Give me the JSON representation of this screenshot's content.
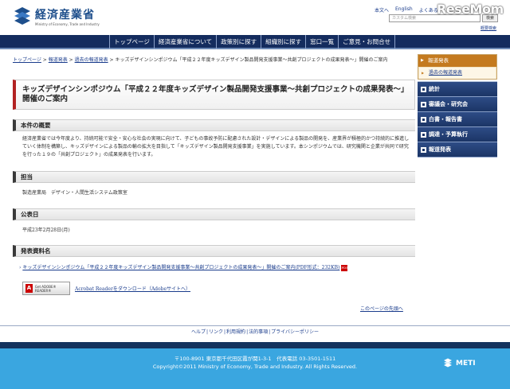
{
  "header": {
    "logo_text": "経済産業省",
    "logo_sub": "Ministry of Economy, Trade and Industry",
    "top_links": [
      "本文へ",
      "English",
      "よくある"
    ],
    "search_placeholder": "カスタム検索",
    "search_button": "検索",
    "sitemap": "概要検索",
    "watermark": "ReseMom"
  },
  "nav": {
    "items": [
      "トップページ",
      "経済産業省について",
      "政策別に探す",
      "組織別に探す",
      "窓口一覧",
      "ご意見・お問合せ"
    ]
  },
  "breadcrumb": {
    "items": [
      "トップページ",
      "報道発表",
      "過去の報道発表"
    ],
    "current": "キッズデザインシンポジウム「平成２２年度キッズデザイン製品開発支援事業〜共創プロジェクトの成果発表〜」開催のご案内"
  },
  "page_title": "キッズデザインシンポジウム「平成２２年度キッズデザイン製品開発支援事業〜共創プロジェクトの成果発表〜」開催のご案内",
  "sections": {
    "summary": {
      "heading": "本件の概要",
      "text": "経済産業省では今年度より、持続可能で安全・安心な社会の実現に向けて、子どもの事故予防に配慮された設計・デザインによる製品の開発を、産業界が積極的かつ持続的に推進していく体制を構築し、キッズデザインによる製品の輸の拡大を目指して「キッズデザイン製品開発支援事業」を実施しています。本シンポジウムでは、研究機関と企業が共同で研究を行った１９の「共創プロジェクト」の成果発表を行います。"
    },
    "contact": {
      "heading": "担当",
      "text": "製造産業局　デザイン・人間生活システム政策室"
    },
    "date": {
      "heading": "公表日",
      "text": "平成23年2月28日(月)"
    },
    "materials": {
      "heading": "発表資料名",
      "pdf_link": "キッズデザインシンポジウム「平成２２年度キッズデザイン製品開発支援事業〜共創プロジェクトの成果発表〜」開催のご案内(PDF形式：232KB)",
      "pdf_icon": "PDF",
      "adobe_badge": "Get ADOBE® READER®",
      "acrobat_link": "Acrobat Readerをダウンロード（Adobeサイトへ）",
      "page_top": "このページの先頭へ"
    }
  },
  "sidebar": {
    "news_heading": "報道発表",
    "news_link": "過去の報道発表",
    "menu": [
      "統計",
      "審議会・研究会",
      "白書・報告書",
      "調達・予算執行",
      "報道発表"
    ]
  },
  "footer": {
    "links": [
      "ヘルプ",
      "リンク",
      "利用規約",
      "法的事項",
      "プライバシーポリシー"
    ],
    "address": "〒100-8901 東京都千代田区霞が関1-3-1　代表電話 03-3501-1511",
    "copyright": "Copyright©2011 Ministry of Economy, Trade and Industry. All Rights Reserved.",
    "meti": "METI"
  },
  "colors": {
    "nav_bg": "#142c5e",
    "accent_red": "#b22222",
    "side_orange": "#c47a1f",
    "footer_blue": "#3aa6e0"
  }
}
